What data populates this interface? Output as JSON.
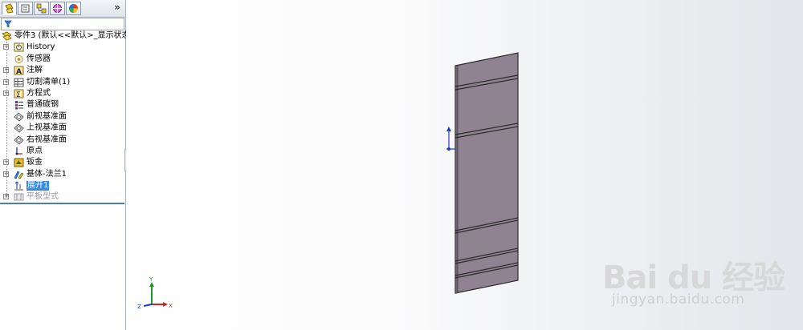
{
  "tabs": [
    {
      "name": "feature-manager-tab-icon",
      "active": true
    },
    {
      "name": "property-manager-tab-icon",
      "active": false
    },
    {
      "name": "configuration-manager-tab-icon",
      "active": false
    },
    {
      "name": "dimxpert-manager-tab-icon",
      "active": false
    },
    {
      "name": "display-manager-tab-icon",
      "active": false
    }
  ],
  "tabs_more": "»",
  "tree": {
    "root": "零件3  (默认<<默认>_显示状态",
    "items": [
      {
        "label": "History",
        "icon": "history-icon",
        "expandable": true
      },
      {
        "label": "传感器",
        "icon": "sensors-icon",
        "expandable": false
      },
      {
        "label": "注解",
        "icon": "annotations-icon",
        "expandable": true
      },
      {
        "label": "切割清单(1)",
        "icon": "cut-list-icon",
        "expandable": true
      },
      {
        "label": "方程式",
        "icon": "equations-icon",
        "expandable": true
      },
      {
        "label": "普通碳钢",
        "icon": "material-icon",
        "expandable": false
      },
      {
        "label": "前视基准面",
        "icon": "plane-icon",
        "expandable": false
      },
      {
        "label": "上视基准面",
        "icon": "plane-icon",
        "expandable": false
      },
      {
        "label": "右视基准面",
        "icon": "plane-icon",
        "expandable": false
      },
      {
        "label": "原点",
        "icon": "origin-icon",
        "expandable": false
      },
      {
        "label": "钣金",
        "icon": "sheet-metal-icon",
        "expandable": true
      },
      {
        "label": "基体-法兰1",
        "icon": "base-flange-icon",
        "expandable": true
      },
      {
        "label": "展开1",
        "icon": "unfold-icon",
        "expandable": false,
        "selected": true
      },
      {
        "label": "平板型式",
        "icon": "flat-pattern-icon",
        "expandable": true,
        "disabled": true
      }
    ]
  },
  "triad": {
    "x": "X",
    "y": "Y",
    "z": "Z"
  },
  "watermark": {
    "logo": "Bai du 经验",
    "url": "jingyan.baidu.com"
  },
  "colors": {
    "part_face": "#8f8391",
    "selection": "#3b8be4",
    "triad_x": "#d21e1e",
    "triad_y": "#1e9a2a",
    "triad_z": "#1e3cc8"
  }
}
